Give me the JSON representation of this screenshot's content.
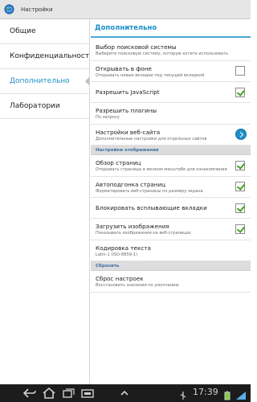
{
  "app": {
    "title": "Настройки"
  },
  "left_menu": [
    {
      "label": "Общие",
      "active": false
    },
    {
      "label": "Конфиденциальность и",
      "active": false
    },
    {
      "label": "Дополнительно",
      "active": true
    },
    {
      "label": "Лаборатории",
      "active": false
    }
  ],
  "main": {
    "header": "Дополнительно",
    "rows": {
      "search_engine": {
        "title": "Выбор поисковой системы",
        "subtitle": "Выберите поисковую систему, которую хотите использовать"
      },
      "open_background": {
        "title": "Открывать в фоне",
        "subtitle": "Открывать новые вкладки под текущей вкладкой",
        "checked": false
      },
      "javascript": {
        "title": "Разрешить JavaScript",
        "checked": true
      },
      "plugins": {
        "title": "Разрешить плагины",
        "subtitle": "По запросу"
      },
      "site_settings": {
        "title": "Настройки веб-сайта",
        "subtitle": "Дополнительные настройки для отдельных сайтов"
      },
      "overview": {
        "title": "Обзор страниц",
        "subtitle": "Открывать страницы в мелком масштабе для ознакомления",
        "checked": true
      },
      "autofit": {
        "title": "Автоподгонка страниц",
        "subtitle": "Форматировать веб-страницы по размеру экрана",
        "checked": true
      },
      "block_popups": {
        "title": "Блокировать всплывающие вкладки",
        "checked": true
      },
      "load_images": {
        "title": "Загрузить изображения",
        "subtitle": "Показывать изображения на веб-страницах",
        "checked": true
      },
      "encoding": {
        "title": "Кодировка текста",
        "subtitle": "Latin-1 (ISO-8859-1)"
      },
      "reset": {
        "title": "Сброс настроек",
        "subtitle": "Восстановить значения по умолчанию"
      }
    },
    "sections": {
      "display": "Настройки отображения",
      "reset": "Сбросить"
    }
  },
  "system_bar": {
    "time": "17:39"
  },
  "colors": {
    "accent": "#1f8fc8",
    "check": "#44a323",
    "system_bar": "#1c1c1c"
  },
  "icons": [
    "globe-icon",
    "back-icon",
    "home-icon",
    "recent-apps-icon",
    "screenshot-icon",
    "up-arrow-icon",
    "usb-icon",
    "battery-icon",
    "wifi-icon"
  ]
}
